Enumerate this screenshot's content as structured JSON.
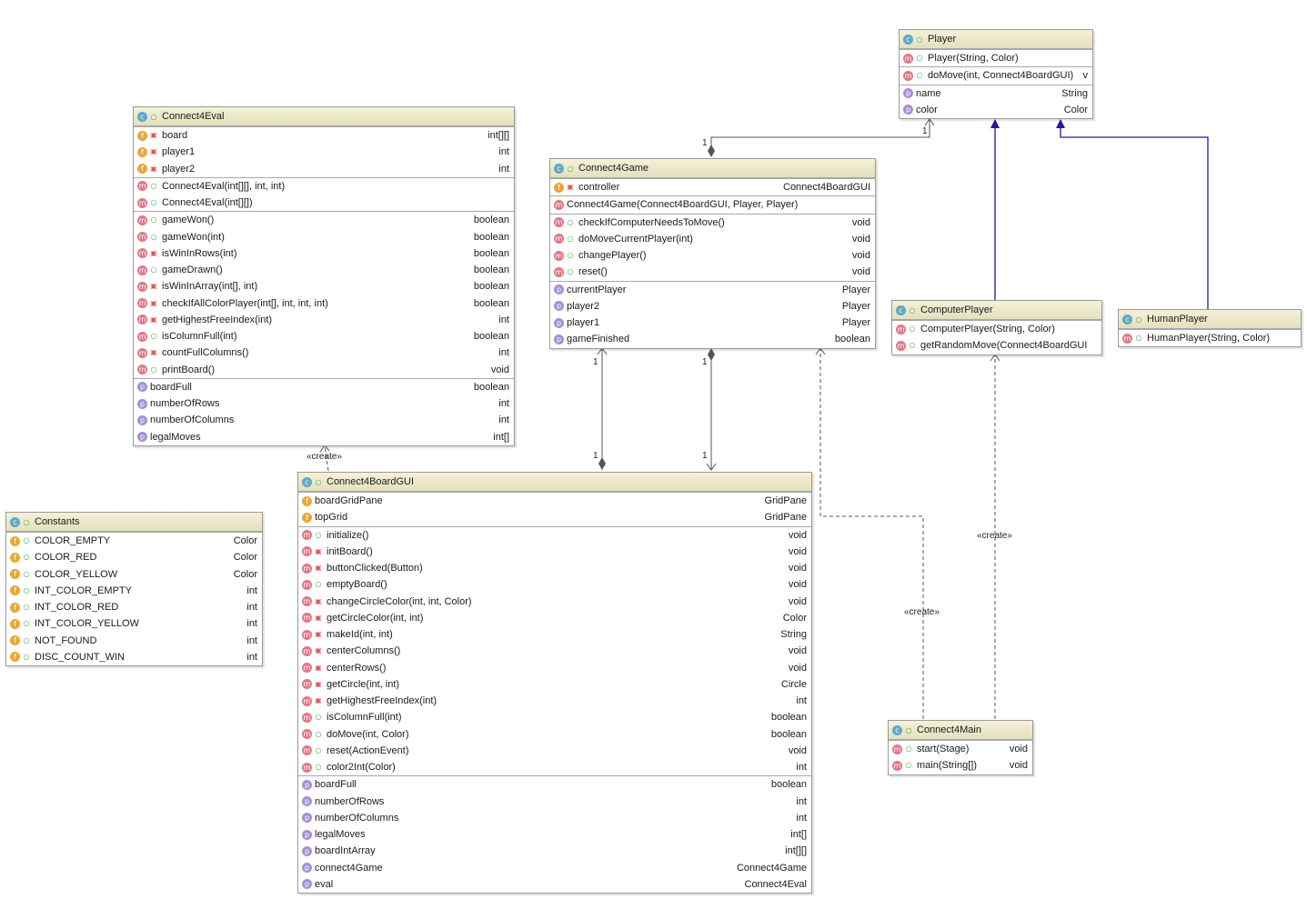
{
  "classes": [
    {
      "id": "player",
      "name": "Player",
      "sections": [
        [
          {
            "kind": "m",
            "vis": "pub",
            "name": "Player(String, Color)",
            "type": ""
          }
        ],
        [
          {
            "kind": "m",
            "vis": "pub",
            "name": "doMove(int, Connect4BoardGUI)",
            "type": "v"
          }
        ],
        [
          {
            "kind": "p",
            "vis": "",
            "name": "name",
            "type": "String"
          },
          {
            "kind": "p",
            "vis": "",
            "name": "color",
            "type": "Color"
          }
        ]
      ]
    },
    {
      "id": "connect4eval",
      "name": "Connect4Eval",
      "sections": [
        [
          {
            "kind": "f",
            "vis": "pri",
            "name": "board",
            "type": "int[][]"
          },
          {
            "kind": "f",
            "vis": "pri",
            "name": "player1",
            "type": "int"
          },
          {
            "kind": "f",
            "vis": "pri",
            "name": "player2",
            "type": "int"
          }
        ],
        [
          {
            "kind": "m",
            "vis": "pub",
            "name": "Connect4Eval(int[][], int, int)",
            "type": ""
          },
          {
            "kind": "m",
            "vis": "pub",
            "name": "Connect4Eval(int[][])",
            "type": ""
          }
        ],
        [
          {
            "kind": "m",
            "vis": "pub",
            "name": "gameWon()",
            "type": "boolean"
          },
          {
            "kind": "m",
            "vis": "pub",
            "name": "gameWon(int)",
            "type": "boolean"
          },
          {
            "kind": "m",
            "vis": "pri",
            "name": "isWinInRows(int)",
            "type": "boolean"
          },
          {
            "kind": "m",
            "vis": "pub",
            "name": "gameDrawn()",
            "type": "boolean"
          },
          {
            "kind": "m",
            "vis": "pri",
            "name": "isWinInArray(int[], int)",
            "type": "boolean"
          },
          {
            "kind": "m",
            "vis": "pri",
            "name": "checkIfAllColorPlayer(int[], int, int, int)",
            "type": "boolean"
          },
          {
            "kind": "m",
            "vis": "pri",
            "name": "getHighestFreeIndex(int)",
            "type": "int"
          },
          {
            "kind": "m",
            "vis": "pub",
            "name": "isColumnFull(int)",
            "type": "boolean"
          },
          {
            "kind": "m",
            "vis": "pri",
            "name": "countFullColumns()",
            "type": "int"
          },
          {
            "kind": "m",
            "vis": "pub",
            "name": "printBoard()",
            "type": "void"
          }
        ],
        [
          {
            "kind": "p",
            "vis": "",
            "name": "boardFull",
            "type": "boolean"
          },
          {
            "kind": "p",
            "vis": "",
            "name": "numberOfRows",
            "type": "int"
          },
          {
            "kind": "p",
            "vis": "",
            "name": "numberOfColumns",
            "type": "int"
          },
          {
            "kind": "p",
            "vis": "",
            "name": "legalMoves",
            "type": "int[]"
          }
        ]
      ]
    },
    {
      "id": "connect4game",
      "name": "Connect4Game",
      "sections": [
        [
          {
            "kind": "f",
            "vis": "pri",
            "name": "controller",
            "type": "Connect4BoardGUI"
          }
        ],
        [
          {
            "kind": "m",
            "vis": "",
            "name": "Connect4Game(Connect4BoardGUI, Player, Player)",
            "type": ""
          }
        ],
        [
          {
            "kind": "m",
            "vis": "pub",
            "name": "checkIfComputerNeedsToMove()",
            "type": "void"
          },
          {
            "kind": "m",
            "vis": "pub",
            "name": "doMoveCurrentPlayer(int)",
            "type": "void"
          },
          {
            "kind": "m",
            "vis": "pub",
            "name": "changePlayer()",
            "type": "void"
          },
          {
            "kind": "m",
            "vis": "pub",
            "name": "reset()",
            "type": "void"
          }
        ],
        [
          {
            "kind": "p",
            "vis": "",
            "name": "currentPlayer",
            "type": "Player"
          },
          {
            "kind": "p",
            "vis": "",
            "name": "player2",
            "type": "Player"
          },
          {
            "kind": "p",
            "vis": "",
            "name": "player1",
            "type": "Player"
          },
          {
            "kind": "p",
            "vis": "",
            "name": "gameFinished",
            "type": "boolean"
          }
        ]
      ]
    },
    {
      "id": "computerplayer",
      "name": "ComputerPlayer",
      "sections": [
        [
          {
            "kind": "m",
            "vis": "pub",
            "name": "ComputerPlayer(String, Color)",
            "type": ""
          },
          {
            "kind": "m",
            "vis": "pub",
            "name": "getRandomMove(Connect4BoardGUI)",
            "type": ""
          }
        ]
      ]
    },
    {
      "id": "humanplayer",
      "name": "HumanPlayer",
      "sections": [
        [
          {
            "kind": "m",
            "vis": "pub",
            "name": "HumanPlayer(String, Color)",
            "type": ""
          }
        ]
      ]
    },
    {
      "id": "constants",
      "name": "Constants",
      "sections": [
        [
          {
            "kind": "f",
            "vis": "pub",
            "name": "COLOR_EMPTY",
            "type": "Color"
          },
          {
            "kind": "f",
            "vis": "pub",
            "name": "COLOR_RED",
            "type": "Color"
          },
          {
            "kind": "f",
            "vis": "pub",
            "name": "COLOR_YELLOW",
            "type": "Color"
          },
          {
            "kind": "f",
            "vis": "pub",
            "name": "INT_COLOR_EMPTY",
            "type": "int"
          },
          {
            "kind": "f",
            "vis": "pub",
            "name": "INT_COLOR_RED",
            "type": "int"
          },
          {
            "kind": "f",
            "vis": "pub",
            "name": "INT_COLOR_YELLOW",
            "type": "int"
          },
          {
            "kind": "f",
            "vis": "pub",
            "name": "NOT_FOUND",
            "type": "int"
          },
          {
            "kind": "f",
            "vis": "pub",
            "name": "DISC_COUNT_WIN",
            "type": "int"
          }
        ]
      ]
    },
    {
      "id": "connect4boardgui",
      "name": "Connect4BoardGUI",
      "sections": [
        [
          {
            "kind": "f",
            "vis": "",
            "name": "boardGridPane",
            "type": "GridPane"
          },
          {
            "kind": "f",
            "vis": "",
            "name": "topGrid",
            "type": "GridPane"
          }
        ],
        [
          {
            "kind": "m",
            "vis": "pub",
            "name": "initialize()",
            "type": "void"
          },
          {
            "kind": "m",
            "vis": "pri",
            "name": "initBoard()",
            "type": "void"
          },
          {
            "kind": "m",
            "vis": "pri",
            "name": "buttonClicked(Button)",
            "type": "void"
          },
          {
            "kind": "m",
            "vis": "pub",
            "name": "emptyBoard()",
            "type": "void"
          },
          {
            "kind": "m",
            "vis": "pri",
            "name": "changeCircleColor(int, int, Color)",
            "type": "void"
          },
          {
            "kind": "m",
            "vis": "pri",
            "name": "getCircleColor(int, int)",
            "type": "Color"
          },
          {
            "kind": "m",
            "vis": "pri",
            "name": "makeId(int, int)",
            "type": "String"
          },
          {
            "kind": "m",
            "vis": "pri",
            "name": "centerColumns()",
            "type": "void"
          },
          {
            "kind": "m",
            "vis": "pri",
            "name": "centerRows()",
            "type": "void"
          },
          {
            "kind": "m",
            "vis": "pri",
            "name": "getCircle(int, int)",
            "type": "Circle"
          },
          {
            "kind": "m",
            "vis": "pri",
            "name": "getHighestFreeIndex(int)",
            "type": "int"
          },
          {
            "kind": "m",
            "vis": "pub",
            "name": "isColumnFull(int)",
            "type": "boolean"
          },
          {
            "kind": "m",
            "vis": "pub",
            "name": "doMove(int, Color)",
            "type": "boolean"
          },
          {
            "kind": "m",
            "vis": "pub",
            "name": "reset(ActionEvent)",
            "type": "void"
          },
          {
            "kind": "m",
            "vis": "pub",
            "name": "color2Int(Color)",
            "type": "int"
          }
        ],
        [
          {
            "kind": "p",
            "vis": "",
            "name": "boardFull",
            "type": "boolean"
          },
          {
            "kind": "p",
            "vis": "",
            "name": "numberOfRows",
            "type": "int"
          },
          {
            "kind": "p",
            "vis": "",
            "name": "numberOfColumns",
            "type": "int"
          },
          {
            "kind": "p",
            "vis": "",
            "name": "legalMoves",
            "type": "int[]"
          },
          {
            "kind": "p",
            "vis": "",
            "name": "boardIntArray",
            "type": "int[][]"
          },
          {
            "kind": "p",
            "vis": "",
            "name": "connect4Game",
            "type": "Connect4Game"
          },
          {
            "kind": "p",
            "vis": "",
            "name": "eval",
            "type": "Connect4Eval"
          }
        ]
      ]
    },
    {
      "id": "connect4main",
      "name": "Connect4Main",
      "sections": [
        [
          {
            "kind": "m",
            "vis": "pub",
            "name": "start(Stage)",
            "type": "void"
          },
          {
            "kind": "m",
            "vis": "pub",
            "name": "main(String[])",
            "type": "void"
          }
        ]
      ]
    }
  ],
  "relations": {
    "create_label": "«create»",
    "mult_one": "1"
  },
  "colors": {
    "inheritance": "#1b1b9e",
    "association": "#555555"
  }
}
